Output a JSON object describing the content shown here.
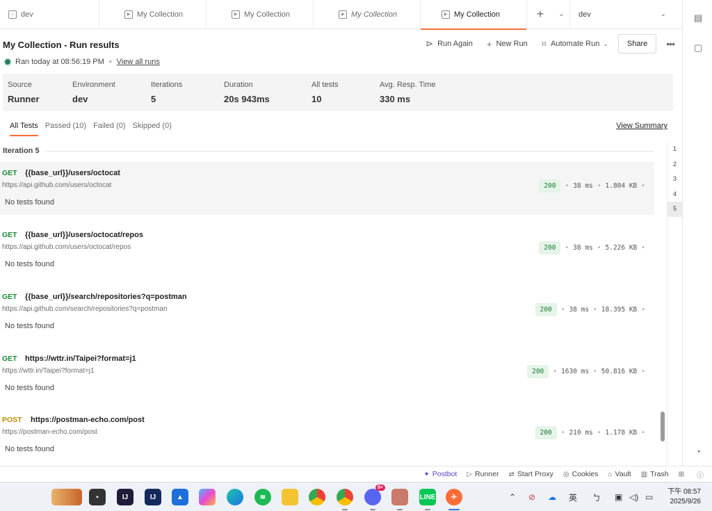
{
  "tabs": [
    {
      "label": "dev",
      "width": 143
    },
    {
      "label": "My Collection",
      "width": 154
    },
    {
      "label": "My Collection",
      "width": 154
    },
    {
      "label": "My Collection",
      "width": 154,
      "italic": true
    },
    {
      "label": "My Collection",
      "width": 153,
      "active": true
    }
  ],
  "env_label": "dev",
  "header": {
    "title": "My Collection - Run results",
    "run_again": "Run Again",
    "new_run": "New Run",
    "automate_run": "Automate Run",
    "share": "Share",
    "ran_text": "Ran today at 08:56:19 PM",
    "view_all_runs": "View all runs"
  },
  "summary": [
    {
      "label": "Source",
      "value": "Runner"
    },
    {
      "label": "Environment",
      "value": "dev"
    },
    {
      "label": "Iterations",
      "value": "5"
    },
    {
      "label": "Duration",
      "value": "20s 943ms"
    },
    {
      "label": "All tests",
      "value": "10"
    },
    {
      "label": "Avg. Resp. Time",
      "value": "330 ms"
    }
  ],
  "filters": {
    "all": "All Tests",
    "passed": "Passed (10)",
    "failed": "Failed (0)",
    "skipped": "Skipped (0)",
    "view_summary": "View Summary"
  },
  "iteration_title": "Iteration 5",
  "requests": [
    {
      "method": "GET",
      "name": "{{base_url}}/users/octocat",
      "url": "https://api.github.com/users/octocat",
      "status": "200",
      "time": "38 ms",
      "size": "1.804 KB",
      "note": "No tests found"
    },
    {
      "method": "GET",
      "name": "{{base_url}}/users/octocat/repos",
      "url": "https://api.github.com/users/octocat/repos",
      "status": "200",
      "time": "38 ms",
      "size": "5.226 KB",
      "note": "No tests found"
    },
    {
      "method": "GET",
      "name": "{{base_url}}/search/repositories?q=postman",
      "url": "https://api.github.com/search/repositories?q=postman",
      "status": "200",
      "time": "38 ms",
      "size": "18.395 KB",
      "note": "No tests found"
    },
    {
      "method": "GET",
      "name": "https://wttr.in/Taipei?format=j1",
      "url": "https://wttr.in/Taipei?format=j1",
      "status": "200",
      "time": "1630 ms",
      "size": "50.816 KB",
      "note": "No tests found"
    },
    {
      "method": "POST",
      "name": "https://postman-echo.com/post",
      "url": "https://postman-echo.com/post",
      "status": "200",
      "time": "210 ms",
      "size": "1.178 KB",
      "note": "No tests found"
    }
  ],
  "iterations": [
    "1",
    "2",
    "3",
    "4",
    "5"
  ],
  "statusbar": {
    "postbot": "Postbot",
    "runner": "Runner",
    "start_proxy": "Start Proxy",
    "cookies": "Cookies",
    "vault": "Vault",
    "trash": "Trash"
  },
  "taskbar": {
    "ime": "英",
    "time": "下午 08:57",
    "date": "2025/9/26",
    "discord_badge": "9+"
  },
  "colors": {
    "accent": "#ff6c37",
    "get": "#1b8a3a",
    "post": "#b98a00",
    "status_ok_bg": "#e4f4e8"
  }
}
